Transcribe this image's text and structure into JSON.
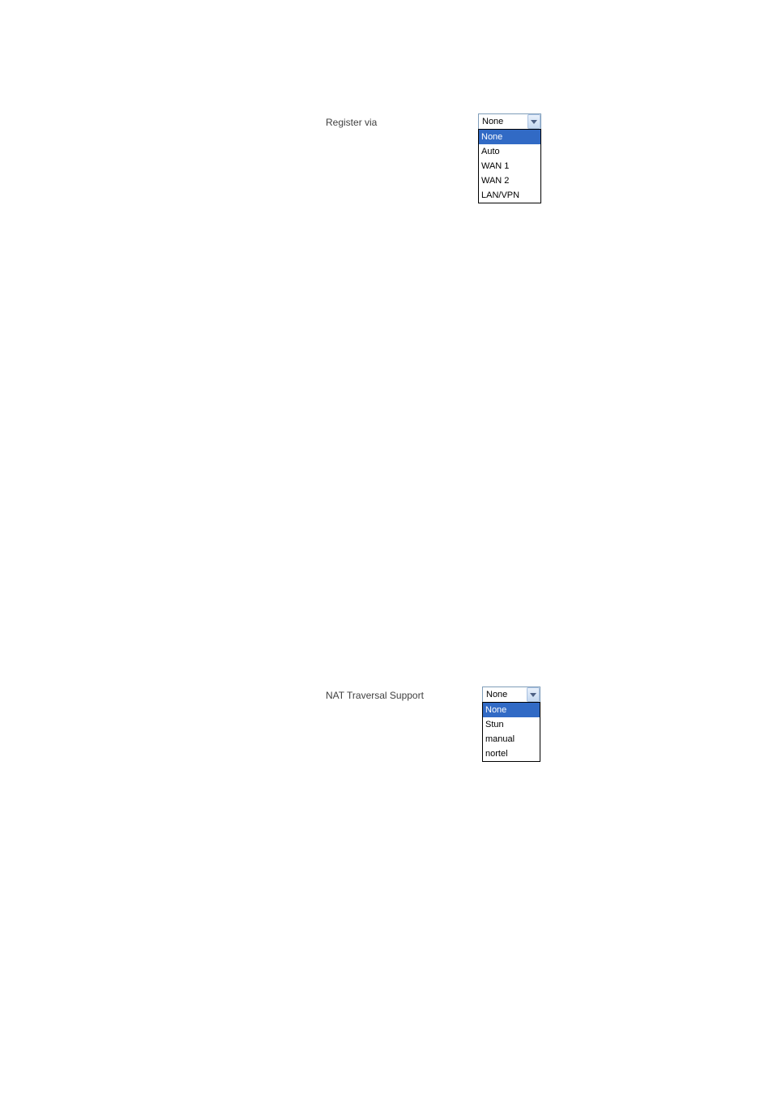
{
  "register_via": {
    "label": "Register via",
    "selected": "None",
    "options": [
      "None",
      "Auto",
      "WAN 1",
      "WAN 2",
      "LAN/VPN"
    ],
    "highlighted_index": 0
  },
  "nat_traversal": {
    "label": "NAT Traversal Support",
    "selected": "None",
    "options": [
      "None",
      "Stun",
      "manual",
      "nortel"
    ],
    "highlighted_index": 0
  }
}
